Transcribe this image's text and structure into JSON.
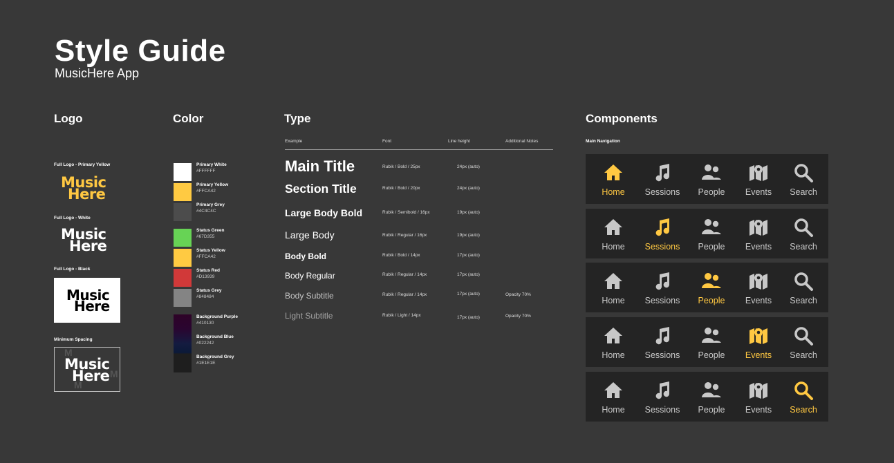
{
  "header": {
    "title": "Style Guide",
    "subtitle": "MusicHere App"
  },
  "logo": {
    "heading": "Logo",
    "primary_label": "Full Logo - Primary Yellow",
    "white_label": "Full Logo - White",
    "black_label": "Full Logo - Black",
    "spacing_label": "Minimum Spacing",
    "mark_line1": "Music",
    "mark_line2": "Here",
    "spacing_marker": "M"
  },
  "color": {
    "heading": "Color",
    "swatches": [
      {
        "name": "Primary White",
        "hex": "#FFFFFF"
      },
      {
        "name": "Primary Yellow",
        "hex": "#FFCA42"
      },
      {
        "name": "Primary Grey",
        "hex": "#4C4C4C"
      },
      {
        "name": "Status Green",
        "hex": "#67D355"
      },
      {
        "name": "Status Yellow",
        "hex": "#FFCA42"
      },
      {
        "name": "Status Red",
        "hex": "#D13939"
      },
      {
        "name": "Status Grey",
        "hex": "#848484"
      },
      {
        "name": "Background Purple",
        "hex": "#410130"
      },
      {
        "name": "Background Blue",
        "hex": "#022242"
      },
      {
        "name": "Background Grey",
        "hex": "#1E1E1E"
      }
    ]
  },
  "type": {
    "heading": "Type",
    "columns": {
      "example": "Example",
      "font": "Font",
      "line_height": "Line height",
      "notes": "Additional Notes"
    },
    "rows": [
      {
        "example": "Main Title",
        "font": "Rubik / Bold / 25px",
        "line_height": "24px (auto)",
        "notes": ""
      },
      {
        "example": "Section Title",
        "font": "Rubik / Bold / 20px",
        "line_height": "24px (auto)",
        "notes": ""
      },
      {
        "example": "Large Body Bold",
        "font": "Rubik / Semibold / 16px",
        "line_height": "19px (auto)",
        "notes": ""
      },
      {
        "example": "Large Body",
        "font": "Rubik / Regular / 16px",
        "line_height": "19px (auto)",
        "notes": ""
      },
      {
        "example": "Body Bold",
        "font": "Rubik / Bold / 14px",
        "line_height": "17px (auto)",
        "notes": ""
      },
      {
        "example": "Body Regular",
        "font": "Rubik / Regular / 14px",
        "line_height": "17px (auto)",
        "notes": ""
      },
      {
        "example": "Body Subtitle",
        "font": "Rubik / Regular / 14px",
        "line_height": "17px (auto)",
        "notes": "Opacity 70%"
      },
      {
        "example": "Light Subtitle",
        "font": "Rubik / Light / 14px",
        "line_height": "17px (auto)",
        "notes": "Opacity 70%"
      }
    ]
  },
  "components": {
    "heading": "Components",
    "nav_label": "Main Navigation",
    "nav_items": [
      {
        "label": "Home",
        "icon": "home-icon"
      },
      {
        "label": "Sessions",
        "icon": "music-note-icon"
      },
      {
        "label": "People",
        "icon": "people-icon"
      },
      {
        "label": "Events",
        "icon": "map-pin-icon"
      },
      {
        "label": "Search",
        "icon": "search-icon"
      }
    ],
    "active_color": "#FFC842",
    "inactive_color": "#C8C8C8"
  }
}
